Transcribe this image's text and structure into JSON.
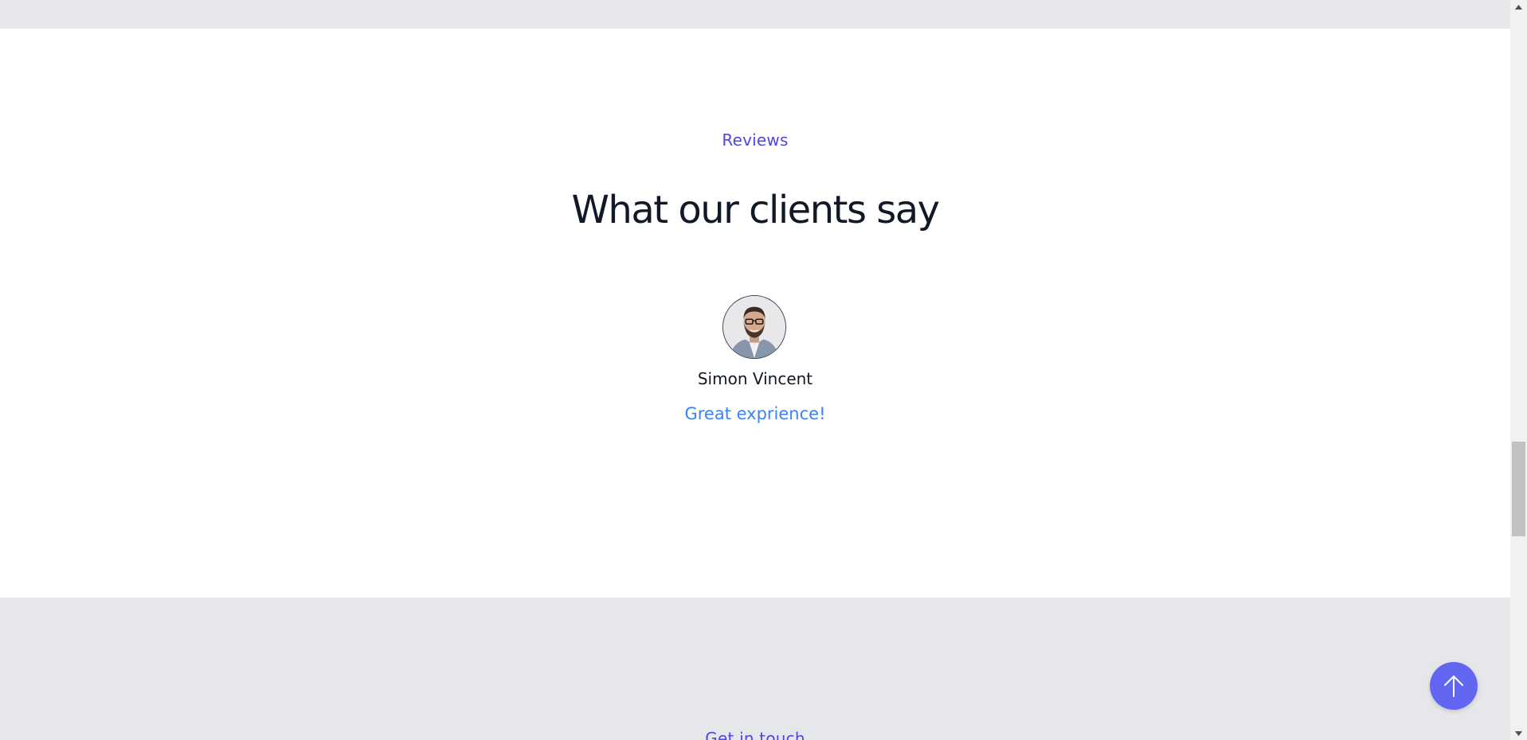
{
  "reviews": {
    "eyebrow": "Reviews",
    "title": "What our clients say",
    "items": [
      {
        "name": "Simon Vincent",
        "quote": "Great exprience!"
      }
    ]
  },
  "contact": {
    "eyebrow": "Get in touch"
  },
  "icons": {
    "scroll_top": "arrow-up-icon",
    "avatar": "avatar-photo"
  },
  "colors": {
    "accent": "#4f46e5",
    "quote": "#3b82f6",
    "scroll_button": "#6366f1",
    "band": "#e5e7eb",
    "heading": "#111827"
  }
}
